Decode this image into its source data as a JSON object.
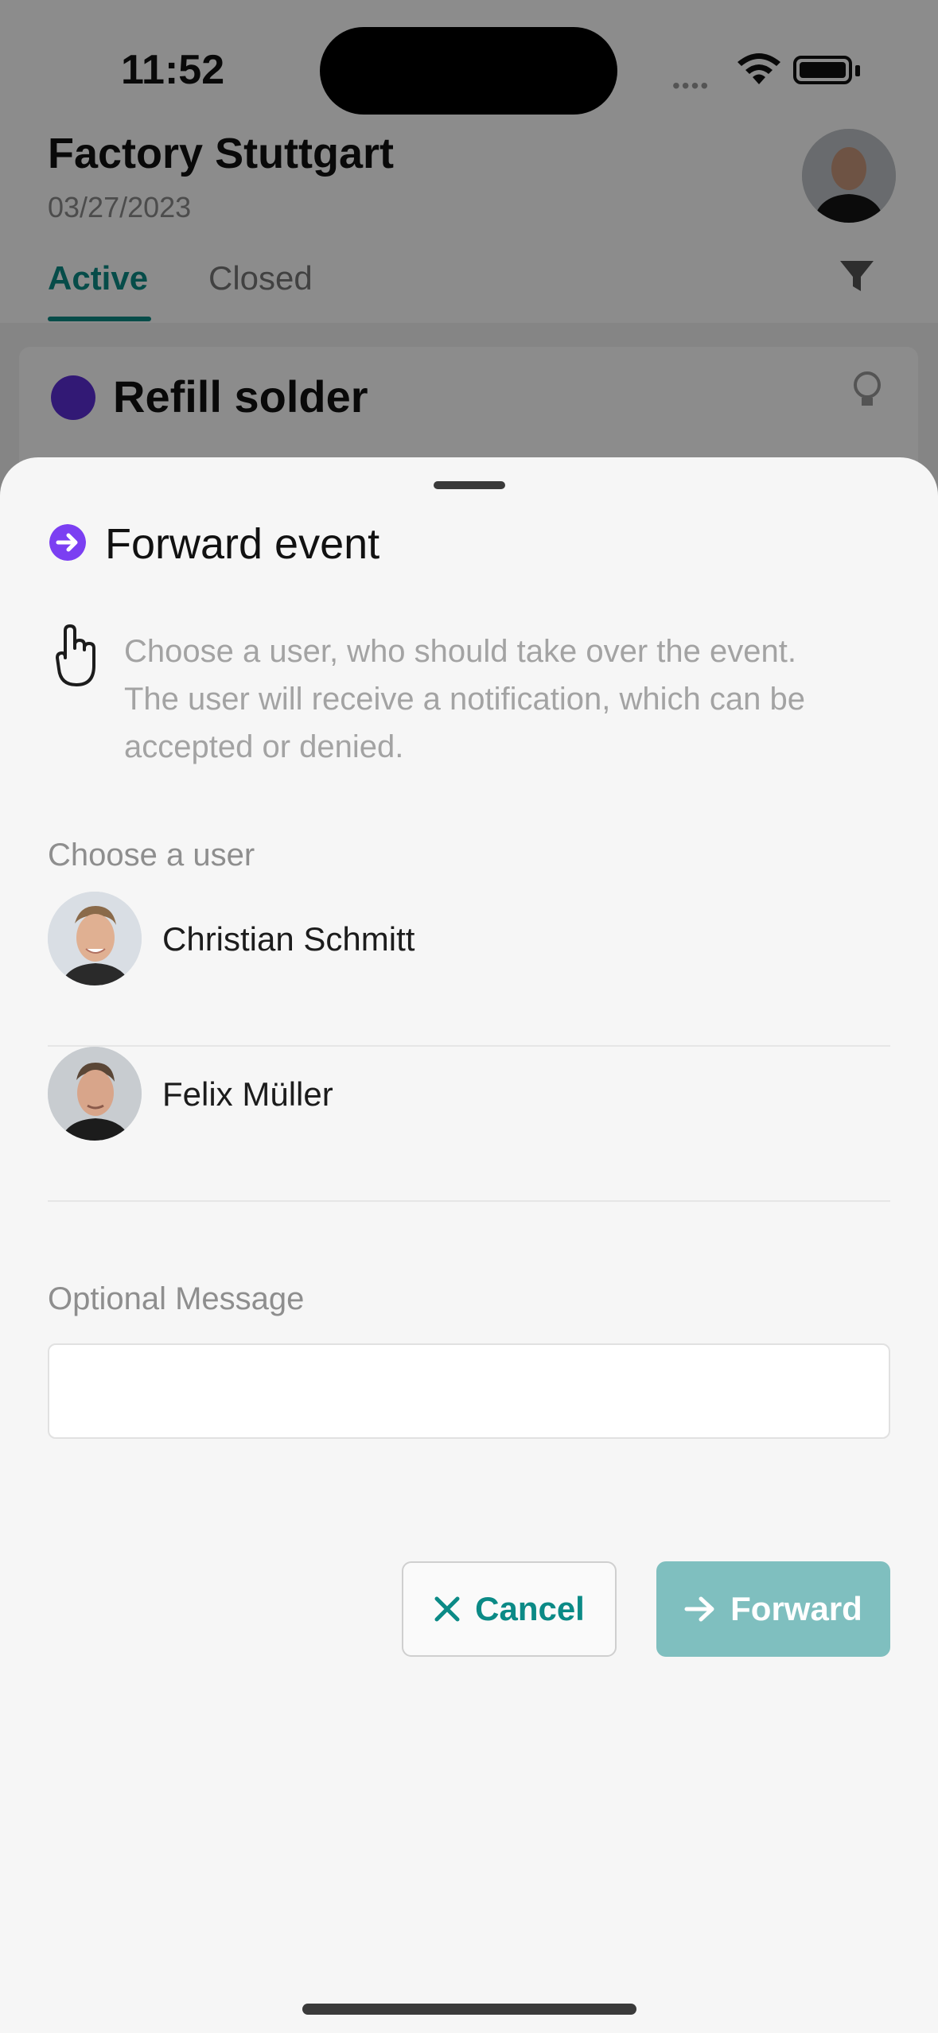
{
  "status_bar": {
    "time": "11:52"
  },
  "background": {
    "title": "Factory Stuttgart",
    "date": "03/27/2023",
    "tabs": [
      {
        "label": "Active"
      },
      {
        "label": "Closed"
      }
    ],
    "card_title": "Refill solder"
  },
  "sheet": {
    "title": "Forward event",
    "hint": "Choose a user, who should take over the event. The user will receive a notification, which can be accepted or denied.",
    "choose_label": "Choose a user",
    "users": [
      {
        "name": "Christian Schmitt"
      },
      {
        "name": "Felix Müller"
      }
    ],
    "message_label": "Optional Message",
    "message_value": "",
    "cancel_label": "Cancel",
    "forward_label": "Forward"
  },
  "colors": {
    "accent": "#0b8a86",
    "forward_disabled": "#7fbfbf",
    "event_icon": "#7b3ff2"
  }
}
